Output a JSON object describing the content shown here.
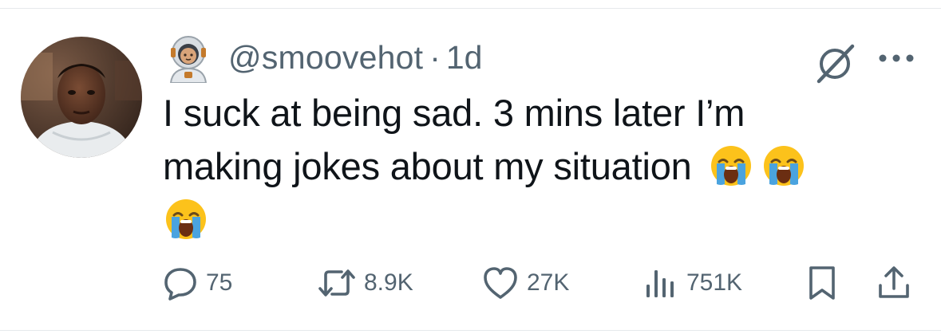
{
  "tweet": {
    "handle": "@smoovehot",
    "separator": "·",
    "time": "1d",
    "text_line1": "I suck at being sad. 3 mins later I’m",
    "text_line2": "making jokes about my situation",
    "emoji_name": "loudly-crying-face"
  },
  "actions": {
    "replies": "75",
    "reposts": "8.9K",
    "likes": "27K",
    "views": "751K"
  },
  "icons": {
    "reply": "reply-icon",
    "repost": "repost-icon",
    "like": "heart-icon",
    "views": "views-icon",
    "bookmark": "bookmark-icon",
    "share": "share-icon",
    "grok": "grok-icon",
    "more": "more-icon",
    "badge": "astronaut-emoji-icon"
  },
  "colors": {
    "text": "#0f1419",
    "secondary": "#536471",
    "divider": "#e6e9ec"
  }
}
